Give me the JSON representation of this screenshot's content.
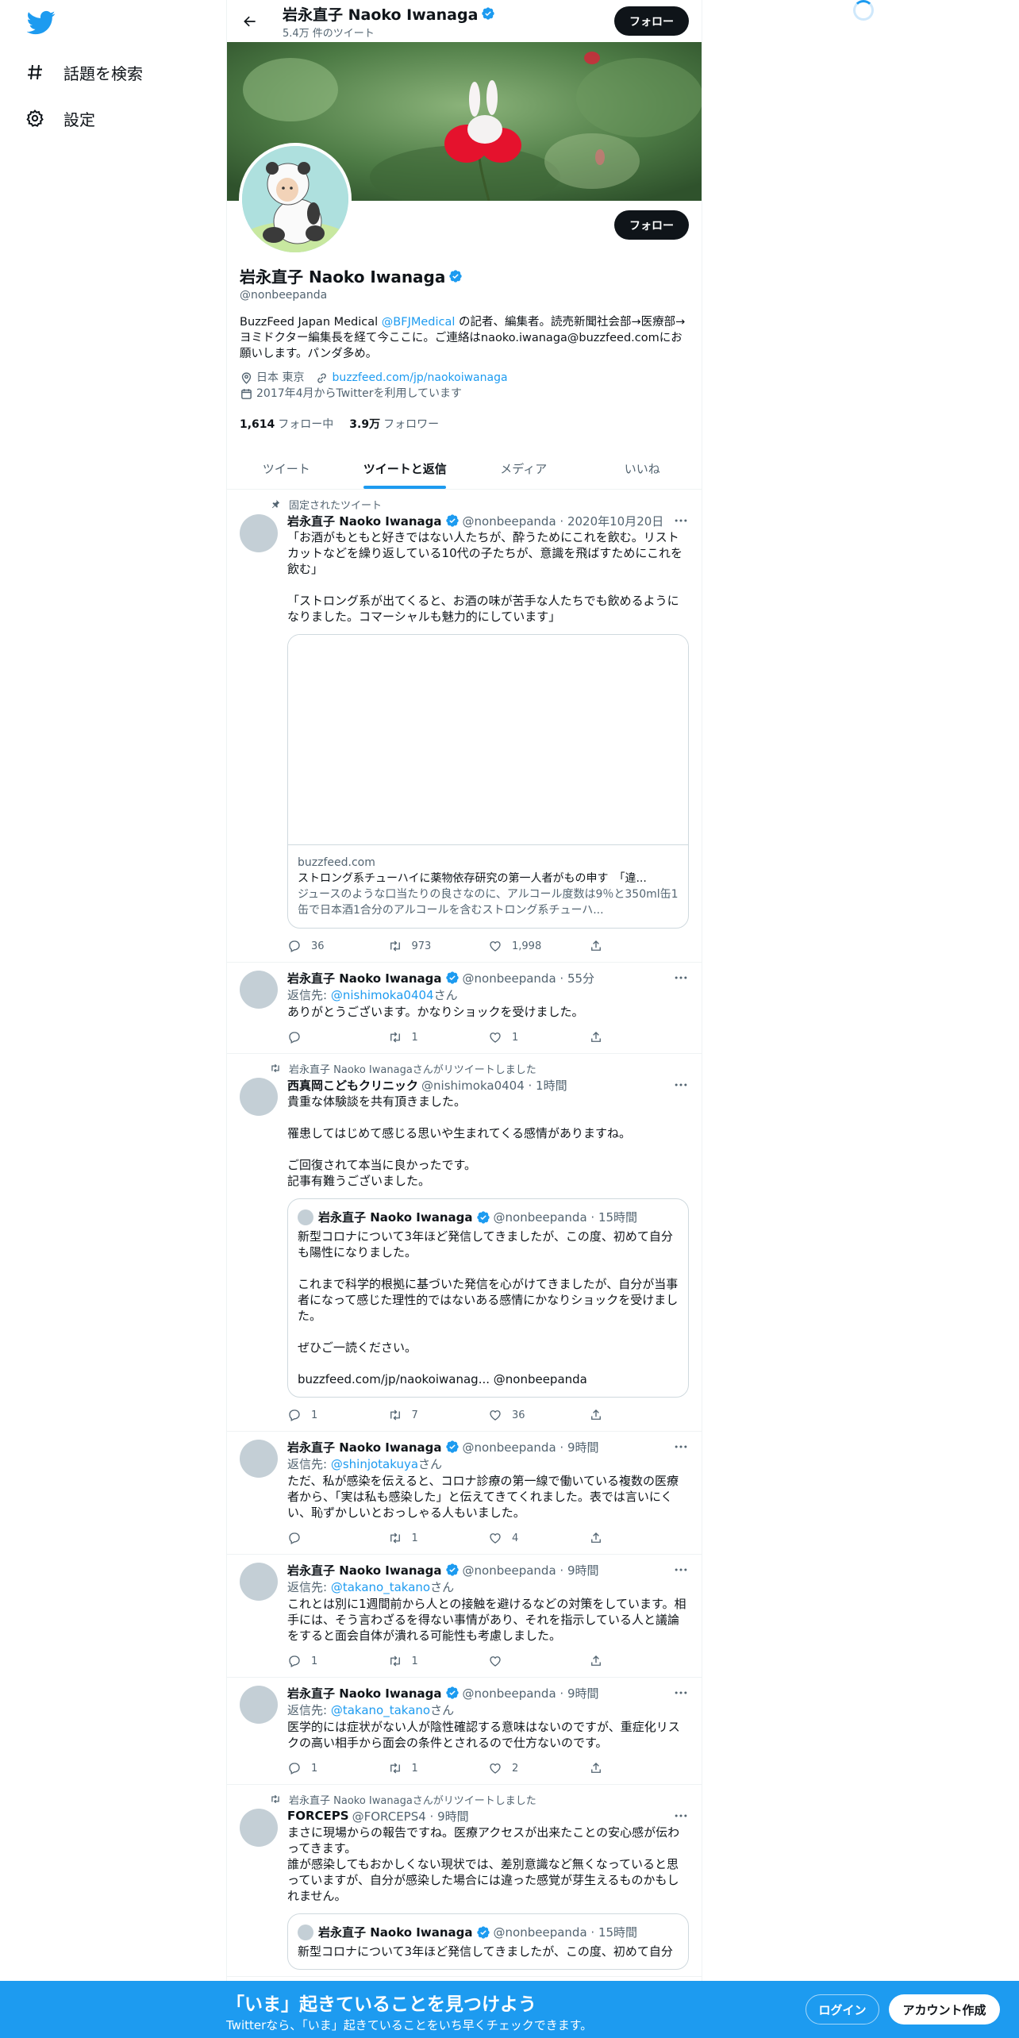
{
  "nav": {
    "items": [
      {
        "label": "話題を検索",
        "icon": "hashtag-icon"
      },
      {
        "label": "設定",
        "icon": "gear-icon"
      }
    ]
  },
  "header": {
    "name": "岩永直子 Naoko Iwanaga",
    "tweet_count": "5.4万 件のツイート",
    "follow_label": "フォロー"
  },
  "profile": {
    "name": "岩永直子 Naoko Iwanaga",
    "handle": "@nonbeepanda",
    "follow_label": "フォロー",
    "bio_pre": "BuzzFeed Japan Medical ",
    "bio_link": "@BFJMedical",
    "bio_post": " の記者、編集者。読売新聞社会部→医療部→ヨミドクター編集長を経て今ここに。ご連絡はnaoko.iwanaga@buzzfeed.comにお願いします。パンダ多め。",
    "location": "日本 東京",
    "url": "buzzfeed.com/jp/naokoiwanaga",
    "joined": "2017年4月からTwitterを利用しています",
    "following_count": "1,614",
    "following_label": "フォロー中",
    "followers_count": "3.9万",
    "followers_label": "フォロワー"
  },
  "tabs": [
    "ツイート",
    "ツイートと返信",
    "メディア",
    "いいね"
  ],
  "active_tab": "ツイートと返信",
  "tweets": [
    {
      "pinned_label": "固定されたツイート",
      "name": "岩永直子 Naoko Iwanaga",
      "meta": "@nonbeepanda · 2020年10月20日",
      "text": "「お酒がもともと好きではない人たちが、酔うためにこれを飲む。リストカットなどを繰り返している10代の子たちが、意識を飛ばすためにこれを飲む」\n\n「ストロング系が出てくると、お酒の味が苦手な人たちでも飲めるようになりました。コマーシャルも魅力的にしています」",
      "card_domain": "buzzfeed.com",
      "card_title": "ストロング系チューハイに薬物依存研究の第一人者がもの申す　「違...",
      "card_desc": "ジュースのような口当たりの良さなのに、アルコール度数は9％と350ml缶1缶で日本酒1合分のアルコールを含むストロング系チューハ...",
      "replies": "36",
      "retweets": "973",
      "likes": "1,998"
    },
    {
      "name": "岩永直子 Naoko Iwanaga",
      "meta": "@nonbeepanda · 55分",
      "reply_prefix": "返信先: ",
      "reply_handle": "@nishimoka0404",
      "reply_suffix": "さん",
      "text": "ありがとうございます。かなりショックを受けました。",
      "replies": "",
      "retweets": "1",
      "likes": "1"
    },
    {
      "retweet_label": "岩永直子 Naoko Iwanagaさんがリツイートしました",
      "name": "西真岡こどもクリニック",
      "meta": "@nishimoka0404 · 1時間",
      "text": "貴重な体験談を共有頂きました。\n\n罹患してはじめて感じる思いや生まれてくる感情がありますね。\n\nご回復されて本当に良かったです。\n記事有難うございました。",
      "quote_name": "岩永直子 Naoko Iwanaga",
      "quote_meta": "@nonbeepanda · 15時間",
      "quote_text": "新型コロナについて3年ほど発信してきましたが、この度、初めて自分も陽性になりました。\n\nこれまで科学的根拠に基づいた発信を心がけてきましたが、自分が当事者になって感じた理性的ではないある感情にかなりショックを受けました。\n\nぜひご一読ください。\n\nbuzzfeed.com/jp/naokoiwanag... @nonbeepanda",
      "replies": "1",
      "retweets": "7",
      "likes": "36"
    },
    {
      "name": "岩永直子 Naoko Iwanaga",
      "meta": "@nonbeepanda · 9時間",
      "reply_prefix": "返信先: ",
      "reply_handle": "@shinjotakuya",
      "reply_suffix": "さん",
      "text": "ただ、私が感染を伝えると、コロナ診療の第一線で働いている複数の医療者から、「実は私も感染した」と伝えてきてくれました。表では言いにくい、恥ずかしいとおっしゃる人もいました。",
      "replies": "",
      "retweets": "1",
      "likes": "4"
    },
    {
      "name": "岩永直子 Naoko Iwanaga",
      "meta": "@nonbeepanda · 9時間",
      "reply_prefix": "返信先: ",
      "reply_handle": "@takano_takano",
      "reply_suffix": "さん",
      "text": "これとは別に1週間前から人との接触を避けるなどの対策をしています。相手には、そう言わざるを得ない事情があり、それを指示している人と議論をすると面会自体が潰れる可能性も考慮しました。",
      "replies": "1",
      "retweets": "1",
      "likes": ""
    },
    {
      "name": "岩永直子 Naoko Iwanaga",
      "meta": "@nonbeepanda · 9時間",
      "reply_prefix": "返信先: ",
      "reply_handle": "@takano_takano",
      "reply_suffix": "さん",
      "text": "医学的には症状がない人が陰性確認する意味はないのですが、重症化リスクの高い相手から面会の条件とされるので仕方ないのです。",
      "replies": "1",
      "retweets": "1",
      "likes": "2"
    },
    {
      "retweet_label": "岩永直子 Naoko Iwanagaさんがリツイートしました",
      "name": "FORCEPS",
      "meta": "@FORCEPS4 · 9時間",
      "text": "まさに現場からの報告ですね。医療アクセスが出来たことの安心感が伝わってきます。\n誰が感染してもおかしくない現状では、差別意識など無くなっていると思っていますが、自分が感染した場合には違った感覚が芽生えるものかもしれません。",
      "quote_name": "岩永直子 Naoko Iwanaga",
      "quote_meta": "@nonbeepanda · 15時間",
      "quote_text": "新型コロナについて3年ほど発信してきましたが、この度、初めて自分"
    }
  ],
  "bottom": {
    "title": "「いま」起きていることを見つけよう",
    "subtitle": "Twitterなら、「いま」起きていることをいち早くチェックできます。",
    "login_label": "ログイン",
    "signup_label": "アカウント作成"
  },
  "colors": {
    "accent": "#1d9bf0",
    "text": "#0f1419",
    "secondary": "#536471",
    "verified": "#1d9bf0"
  }
}
